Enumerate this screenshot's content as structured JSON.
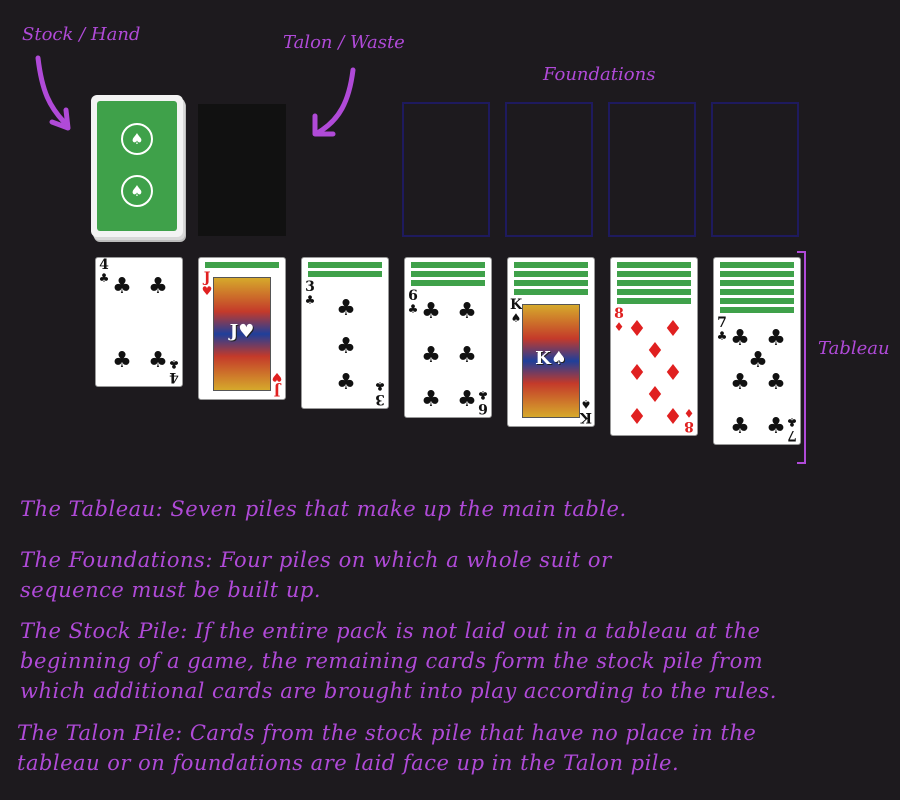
{
  "labels": {
    "stock": "Stock / Hand",
    "talon": "Talon / Waste",
    "foundations": "Foundations",
    "tableau": "Tableau"
  },
  "colors": {
    "accent": "#b04ad8",
    "card_back": "#3fa14a",
    "foundation_border": "#1e1a5e",
    "background": "#1d1a1e"
  },
  "stock": {
    "icon": "spade-emblem-icon",
    "emblem": "♠"
  },
  "tableau": [
    {
      "rank": "4",
      "suit": "♣",
      "color": "black",
      "hidden": 0
    },
    {
      "rank": "J",
      "suit": "♥",
      "color": "red",
      "hidden": 1
    },
    {
      "rank": "3",
      "suit": "♣",
      "color": "black",
      "hidden": 2
    },
    {
      "rank": "6",
      "suit": "♣",
      "color": "black",
      "hidden": 3
    },
    {
      "rank": "K",
      "suit": "♠",
      "color": "black",
      "hidden": 4
    },
    {
      "rank": "8",
      "suit": "♦",
      "color": "red",
      "hidden": 5
    },
    {
      "rank": "7",
      "suit": "♣",
      "color": "black",
      "hidden": 6
    }
  ],
  "descriptions": [
    "The Tableau: Seven piles that make up the main table.",
    "The Foundations: Four piles on which a whole suit or",
    "sequence must be built up.",
    "The Stock Pile: If the entire pack is not laid out in a tableau at the",
    "beginning of a game, the remaining cards form the stock pile from",
    "which additional cards are brought into play according to the rules.",
    "The Talon Pile: Cards from the stock pile that have no place in the",
    "tableau or on foundations are laid face up in the Talon pile."
  ]
}
